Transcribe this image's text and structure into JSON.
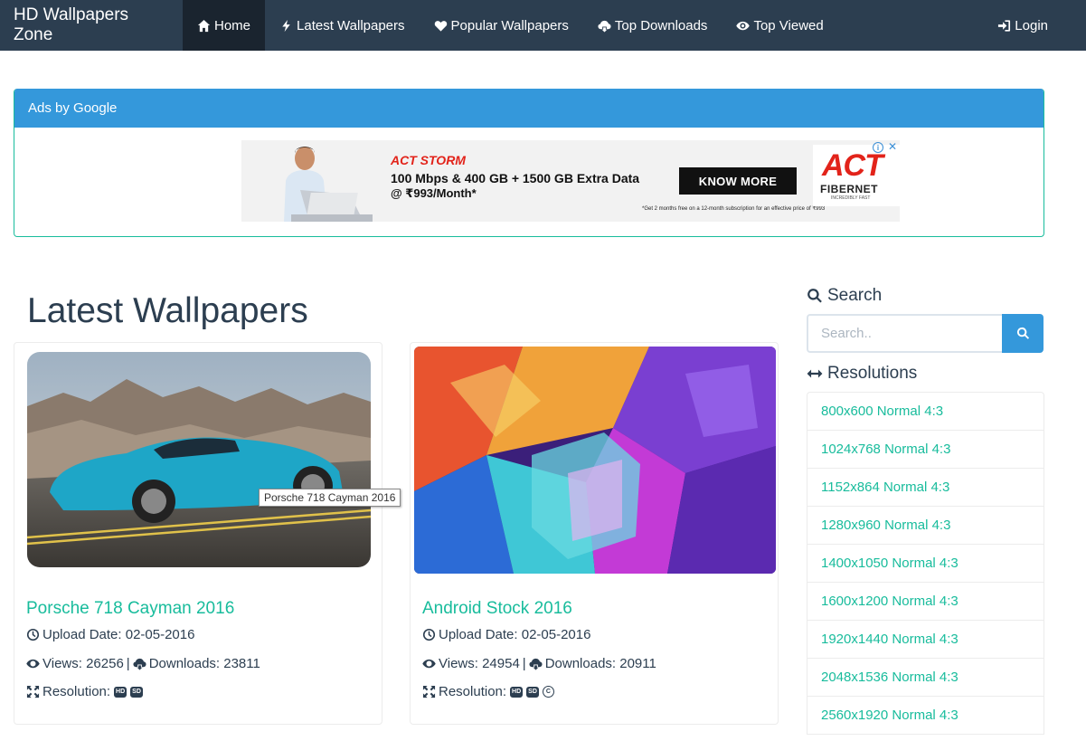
{
  "navbar": {
    "brand": "HD Wallpapers Zone",
    "items": [
      {
        "label": "Home",
        "icon": "home-icon",
        "active": true
      },
      {
        "label": "Latest Wallpapers",
        "icon": "bolt-icon"
      },
      {
        "label": "Popular Wallpapers",
        "icon": "heart-icon"
      },
      {
        "label": "Top Downloads",
        "icon": "cloud-download-icon"
      },
      {
        "label": "Top Viewed",
        "icon": "eye-icon"
      }
    ],
    "login": "Login"
  },
  "ads": {
    "heading": "Ads by Google",
    "banner": {
      "tagline": "ACT STORM",
      "line1": "100 Mbps & 400 GB + 1500 GB Extra Data",
      "line2": "@ ₹993/Month*",
      "button": "KNOW MORE",
      "fineprint": "*Get 2 months free on a 12-month subscription for an effective price of ₹993",
      "logo_act": "ACT",
      "logo_fiber": "FIBERNET",
      "logo_sub": "INCREDIBLY FAST"
    }
  },
  "main": {
    "title": "Latest Wallpapers",
    "cards": [
      {
        "title": "Porsche 718 Cayman 2016",
        "upload": "Upload Date: 02-05-2016",
        "views": "Views: 26256",
        "sep": "|",
        "downloads": "Downloads: 23811",
        "resolution": "Resolution:",
        "badges": [
          "HD",
          "SD"
        ],
        "tooltip": "Porsche 718 Cayman 2016"
      },
      {
        "title": "Android Stock 2016",
        "upload": "Upload Date: 02-05-2016",
        "views": "Views: 24954",
        "sep": "|",
        "downloads": "Downloads: 20911",
        "resolution": "Resolution:",
        "badges": [
          "HD",
          "SD"
        ],
        "extra_badge": "C"
      }
    ]
  },
  "sidebar": {
    "search_heading": "Search",
    "search_placeholder": "Search..",
    "resolutions_heading": "Resolutions",
    "resolutions": [
      "800x600 Normal 4:3",
      "1024x768 Normal 4:3",
      "1152x864 Normal 4:3",
      "1280x960 Normal 4:3",
      "1400x1050 Normal 4:3",
      "1600x1200 Normal 4:3",
      "1920x1440 Normal 4:3",
      "2048x1536 Normal 4:3",
      "2560x1920 Normal 4:3"
    ]
  },
  "colors": {
    "navbar": "#2c3e50",
    "accent": "#18bc9c",
    "primary": "#3498db"
  }
}
